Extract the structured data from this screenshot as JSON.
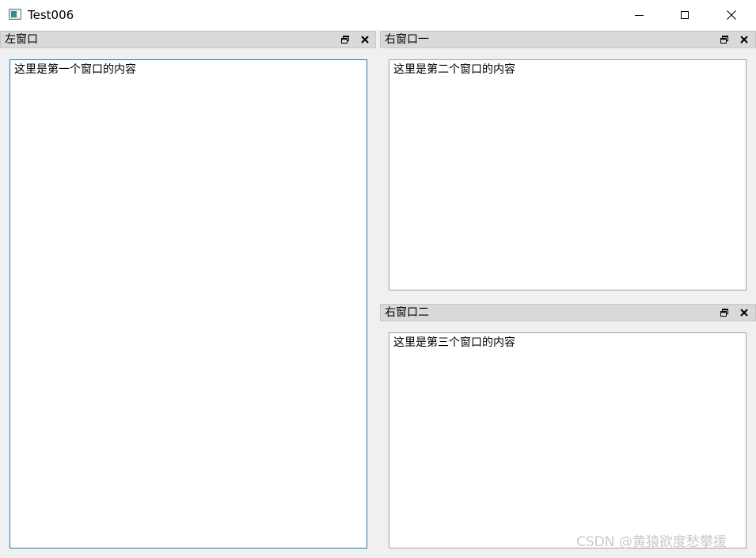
{
  "window": {
    "title": "Test006"
  },
  "docks": {
    "left": {
      "title": "左窗口",
      "content": "这里是第一个窗口的内容"
    },
    "right_top": {
      "title": "右窗口一",
      "content": "这里是第二个窗口的内容"
    },
    "right_bottom": {
      "title": "右窗口二",
      "content": "这里是第三个窗口的内容"
    }
  },
  "watermark": "CSDN @黄猿欲度愁攀援",
  "icons": {
    "app": "app-window-icon",
    "minimize": "minimize-icon",
    "maximize": "maximize-icon",
    "close": "close-icon",
    "dock_float": "float-restore-icon",
    "dock_close": "close-x-icon"
  },
  "colors": {
    "dock_title_bg": "#d9d9d9",
    "focus_border": "#1a7ab8",
    "window_bg": "#f0f0f0"
  }
}
